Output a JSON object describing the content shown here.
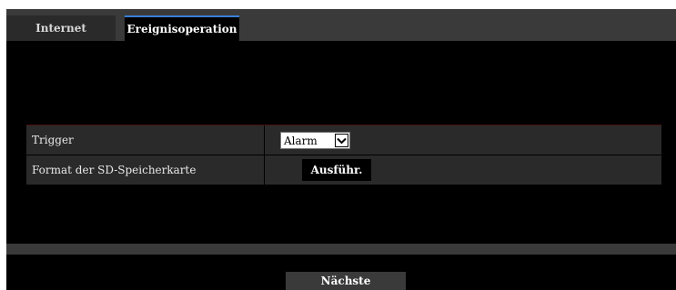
{
  "tabs": [
    {
      "label": "Internet",
      "active": false
    },
    {
      "label": "Ereignisoperation",
      "active": true
    }
  ],
  "settings": {
    "trigger": {
      "label": "Trigger",
      "selected": "Alarm",
      "icon": "chevron-down-icon"
    },
    "sd_format": {
      "label": "Format der SD-Speicherkarte",
      "button_label": "Ausführ."
    }
  },
  "footer": {
    "next_label": "Nächste"
  },
  "colors": {
    "background": "#000000",
    "panel": "#3a3a3a",
    "row": "#2a2a2a",
    "active_tab_accent": "#3a7fd8"
  }
}
